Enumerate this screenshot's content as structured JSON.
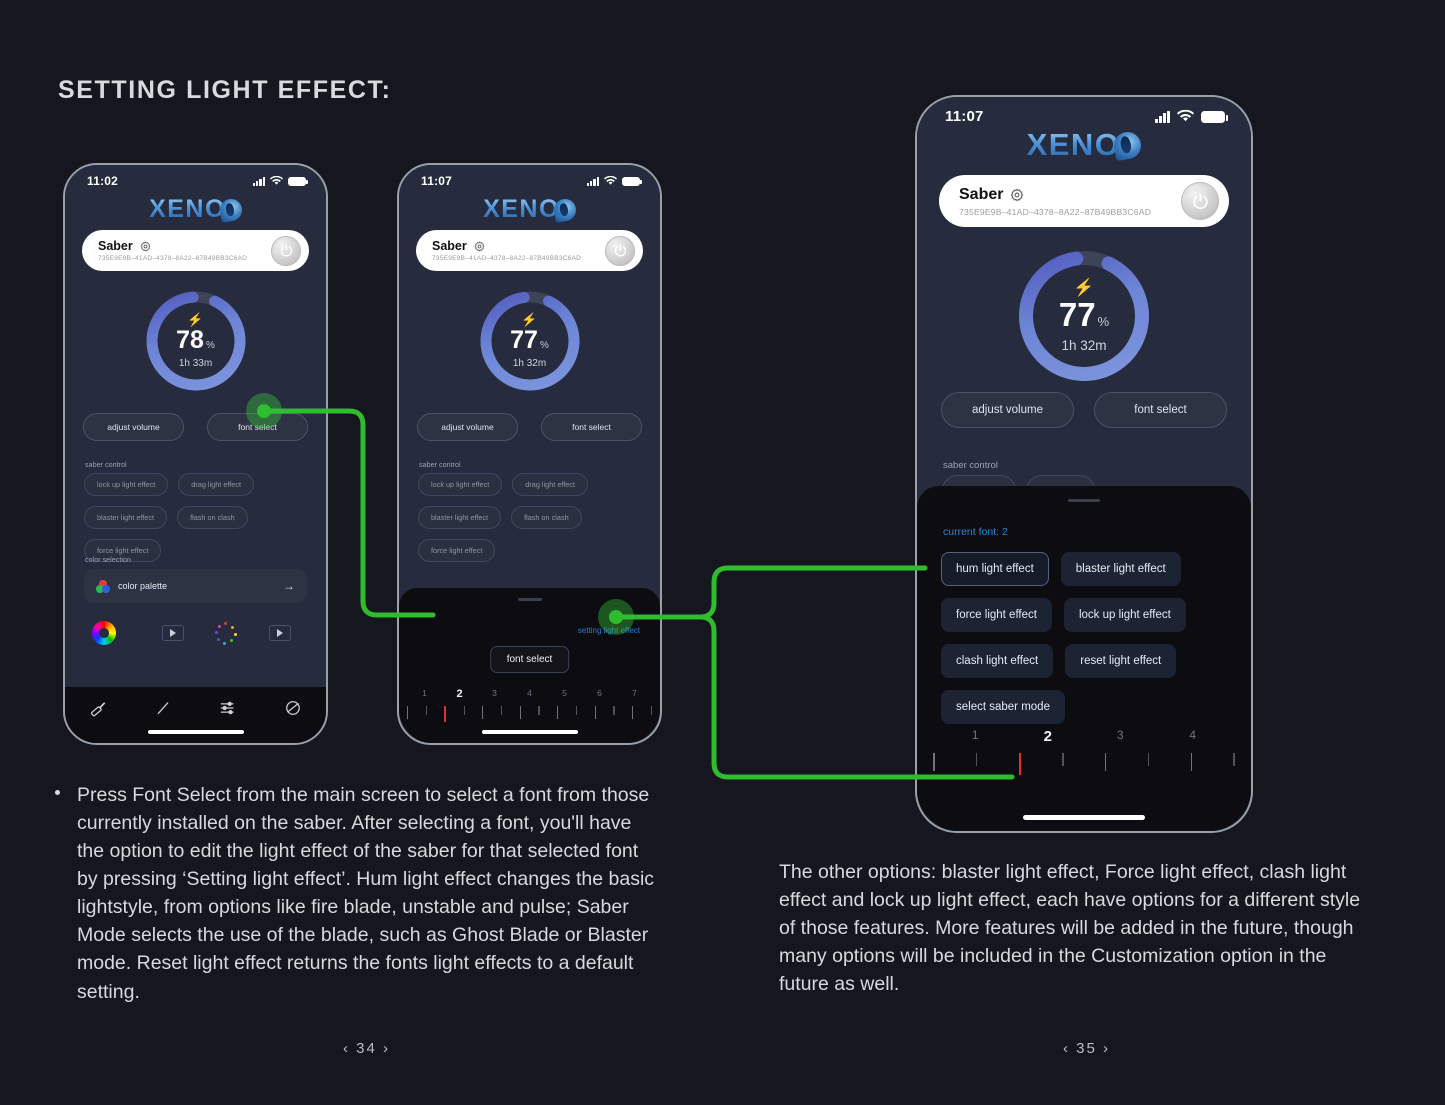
{
  "heading": "SETTING LIGHT EFFECT:",
  "brand": {
    "name": "XENO"
  },
  "phone1": {
    "status": {
      "time": "11:02",
      "signal_icon": "signal-bars-icon",
      "wifi_icon": "wifi-icon",
      "battery_icon": "battery-icon"
    },
    "device": {
      "name": "Saber",
      "gear_icon": "gear-icon",
      "id": "735E9E9B–41AD–4378–8A22–87B49BB3C6AD",
      "power_icon": "power-icon"
    },
    "battery": {
      "percent": "78",
      "percent_symbol": "%",
      "time_remaining": "1h 33m",
      "bolt_icon": "bolt-icon",
      "ring_fill": 0.92
    },
    "buttons": {
      "adjust_volume": "adjust volume",
      "font_select": "font select"
    },
    "saber_control_label": "saber control",
    "saber_control_chips": [
      "lock up light effect",
      "drag light effect",
      "blaster light effect",
      "flash on clash",
      "force light effect"
    ],
    "color_selection_label": "color selection",
    "color_palette": {
      "label": "color palette",
      "arrow_icon": "arrow-right-icon",
      "dots_icon": "color-dots-icon"
    },
    "swatches": [
      {
        "icon": "color-wheel-icon"
      },
      {
        "icon": "play-icon"
      },
      {
        "icon": "sparkle-icon"
      },
      {
        "icon": "play-icon"
      }
    ],
    "tabs": [
      {
        "icon": "saber-hilt-icon",
        "name": "tab-saber"
      },
      {
        "icon": "blade-icon",
        "name": "tab-blade"
      },
      {
        "icon": "sliders-icon",
        "name": "tab-settings"
      },
      {
        "icon": "planet-icon",
        "name": "tab-profile"
      }
    ]
  },
  "phone2": {
    "status": {
      "time": "11:07"
    },
    "device": {
      "name": "Saber",
      "id": "735E9E9B–41AD–4378–8A22–87B49BB3C6AD"
    },
    "battery": {
      "percent": "77",
      "percent_symbol": "%",
      "time_remaining": "1h 32m",
      "ring_fill": 0.91
    },
    "buttons": {
      "adjust_volume": "adjust volume",
      "font_select": "font select"
    },
    "saber_control_label": "saber control",
    "saber_control_chips": [
      "lock up light effect",
      "drag light effect",
      "blaster light effect",
      "flash on clash",
      "force light effect"
    ],
    "sheet": {
      "setting_light_effect_link": "setting light effect",
      "font_select_button": "font select",
      "ruler_numbers": [
        "1",
        "2",
        "3",
        "4",
        "5",
        "6",
        "7"
      ],
      "ruler_current": "2"
    }
  },
  "phone3": {
    "status": {
      "time": "11:07"
    },
    "device": {
      "name": "Saber",
      "id": "735E9E9B–41AD–4378–8A22–87B49BB3C6AD"
    },
    "battery": {
      "percent": "77",
      "percent_symbol": "%",
      "time_remaining": "1h 32m",
      "ring_fill": 0.91
    },
    "buttons": {
      "adjust_volume": "adjust volume",
      "font_select": "font select"
    },
    "saber_control_label": "saber control",
    "sheet": {
      "current_font": "current font: 2",
      "light_effect_buttons": [
        {
          "label": "hum light effect",
          "selected": true
        },
        {
          "label": "blaster light effect",
          "selected": false
        },
        {
          "label": "force light effect",
          "selected": false
        },
        {
          "label": "lock up light effect",
          "selected": false
        },
        {
          "label": "clash light effect",
          "selected": false
        },
        {
          "label": "reset light effect",
          "selected": false
        },
        {
          "label": "select saber mode",
          "selected": false
        }
      ],
      "ruler_numbers": [
        "1",
        "2",
        "3",
        "4"
      ],
      "ruler_current": "2"
    }
  },
  "annotations": {
    "color": "#2fbd2f",
    "callouts": [
      "font select",
      "setting light effect",
      "hum light effect"
    ]
  },
  "body": {
    "left": "Press Font Select from the main screen to select a font from those currently installed on the saber. After selecting a font, you'll have the option to edit the light effect of the saber for that selected font by pressing ‘Setting light effect’. Hum light effect changes the basic lightstyle, from options like fire blade, unstable and pulse; Saber Mode selects the use of the blade, such as Ghost Blade or Blaster mode. Reset light effect returns the fonts light effects to a default setting.",
    "right": "The other options: blaster light effect, Force light effect, clash light effect and lock up light effect, each have options for a different style of those features. More features will be added in the future, though many options will be included in the Customization option in the future as well."
  },
  "page_numbers": {
    "left": "‹ 34 ›",
    "right": "‹ 35 ›"
  }
}
